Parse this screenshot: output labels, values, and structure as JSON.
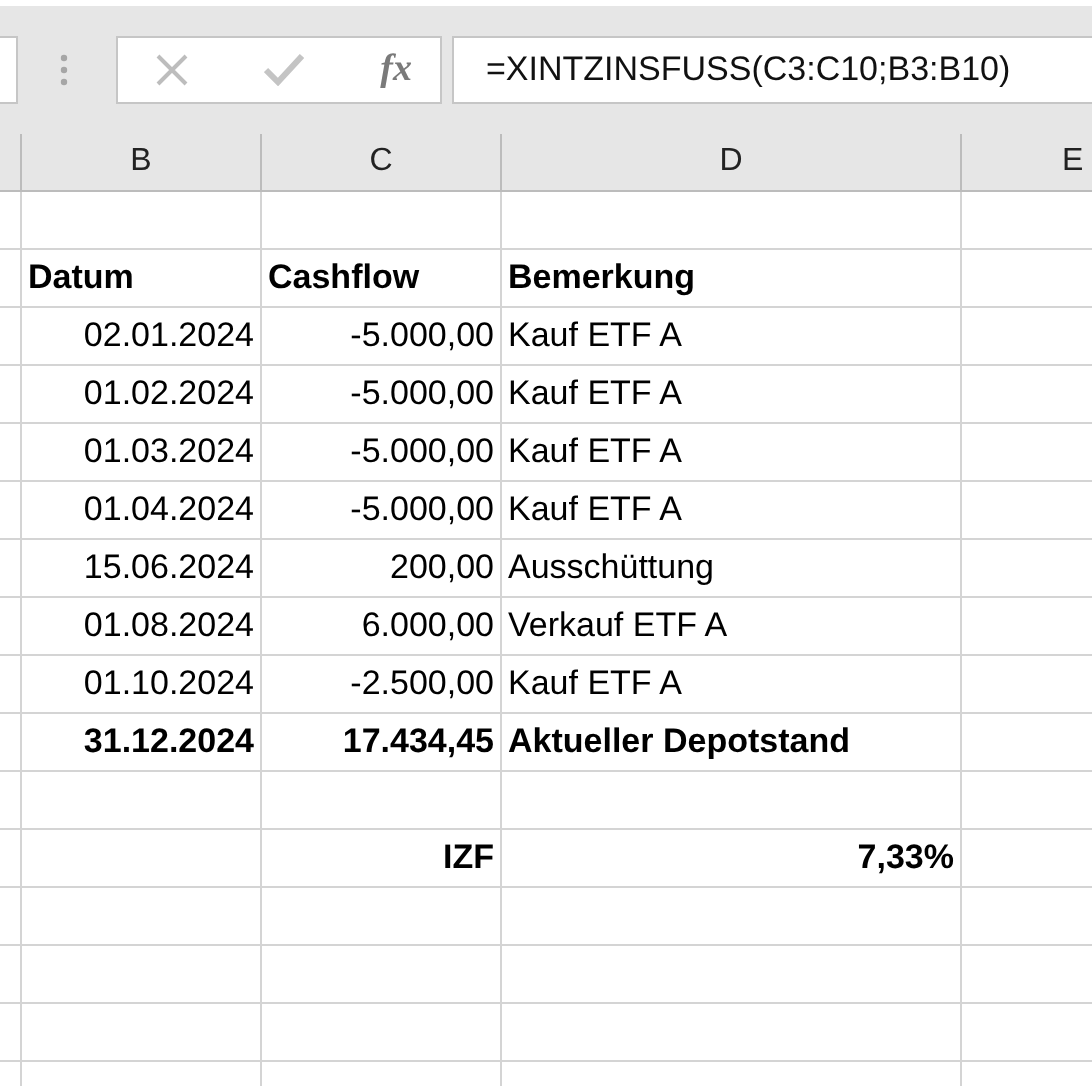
{
  "formula_bar": {
    "function_label": "fx",
    "formula": "=XINTZINSFUSS(C3:C10;B3:B10)"
  },
  "column_headers": [
    "B",
    "C",
    "D",
    "E"
  ],
  "rows": [
    {
      "kind": "empty"
    },
    {
      "kind": "header",
      "b": "Datum",
      "c": "Cashflow",
      "d": "Bemerkung"
    },
    {
      "kind": "entry",
      "b": "02.01.2024",
      "c": "-5.000,00",
      "d": "Kauf ETF A"
    },
    {
      "kind": "entry",
      "b": "01.02.2024",
      "c": "-5.000,00",
      "d": "Kauf ETF A"
    },
    {
      "kind": "entry",
      "b": "01.03.2024",
      "c": "-5.000,00",
      "d": "Kauf ETF A"
    },
    {
      "kind": "entry",
      "b": "01.04.2024",
      "c": "-5.000,00",
      "d": "Kauf ETF A"
    },
    {
      "kind": "entry",
      "b": "15.06.2024",
      "c": "200,00",
      "d": "Ausschüttung"
    },
    {
      "kind": "entry",
      "b": "01.08.2024",
      "c": "6.000,00",
      "d": "Verkauf ETF A"
    },
    {
      "kind": "entry",
      "b": "01.10.2024",
      "c": "-2.500,00",
      "d": "Kauf ETF A"
    },
    {
      "kind": "total",
      "b": "31.12.2024",
      "c": "17.434,45",
      "d": "Aktueller Depotstand"
    },
    {
      "kind": "empty"
    },
    {
      "kind": "result",
      "c": "IZF",
      "d": "7,33%"
    }
  ]
}
